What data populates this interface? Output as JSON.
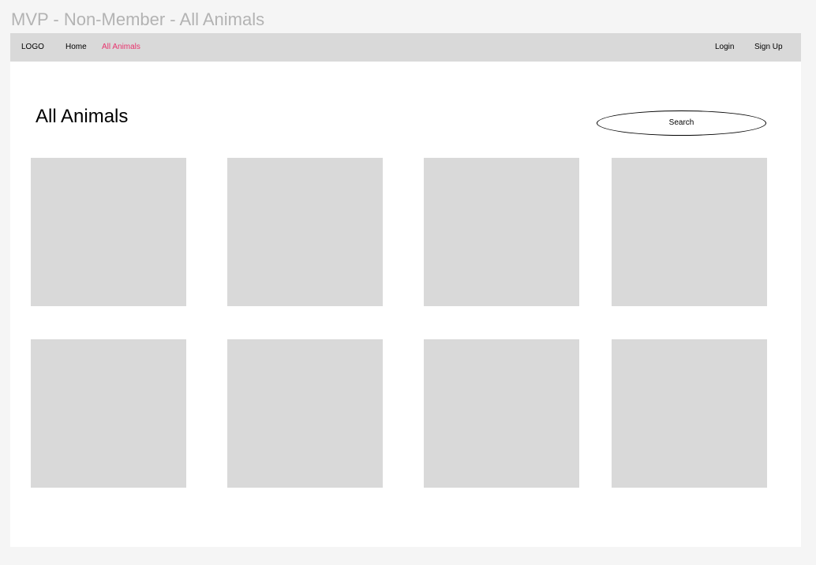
{
  "frame_title": "MVP - Non-Member - All Animals",
  "nav": {
    "logo": "LOGO",
    "home": "Home",
    "all_animals": "All Animals",
    "login": "Login",
    "signup": "Sign Up",
    "active_color": "#e8336d"
  },
  "main": {
    "heading": "All Animals",
    "search_placeholder": "Search"
  },
  "colors": {
    "navbar_bg": "#d9d9d9",
    "card_bg": "#d9d9d9",
    "frame_title": "#b3b3b3"
  },
  "cards": [
    {
      "id": 1
    },
    {
      "id": 2
    },
    {
      "id": 3
    },
    {
      "id": 4
    },
    {
      "id": 5
    },
    {
      "id": 6
    },
    {
      "id": 7
    },
    {
      "id": 8
    }
  ]
}
